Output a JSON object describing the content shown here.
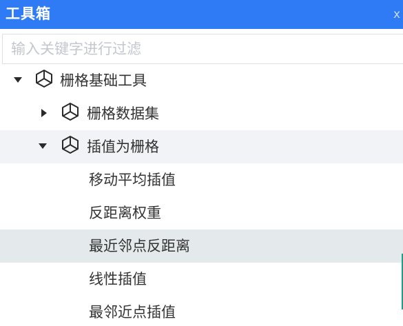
{
  "window": {
    "title": "工具箱",
    "close_glyph": "x"
  },
  "search": {
    "placeholder": "输入关键字进行过滤",
    "value": ""
  },
  "tree": {
    "nodes": [
      {
        "label": "栅格基础工具",
        "level": 0,
        "expanded": true,
        "icon": "cube-icon"
      },
      {
        "label": "栅格数据集",
        "level": 1,
        "expanded": false,
        "icon": "cube-icon"
      },
      {
        "label": "插值为栅格",
        "level": 1,
        "expanded": true,
        "icon": "cube-icon"
      },
      {
        "label": "移动平均插值",
        "level": 2
      },
      {
        "label": "反距离权重",
        "level": 2
      },
      {
        "label": "最近邻点反距离",
        "level": 2,
        "selected": true
      },
      {
        "label": "线性插值",
        "level": 2
      },
      {
        "label": "最邻近点插值",
        "level": 2
      }
    ]
  },
  "colors": {
    "titlebar": "#2f7bf6",
    "hover_row": "#f2f3f6",
    "selected_row": "#e4e9ec",
    "text": "#333333",
    "scroll_accent": "#1aa089"
  }
}
